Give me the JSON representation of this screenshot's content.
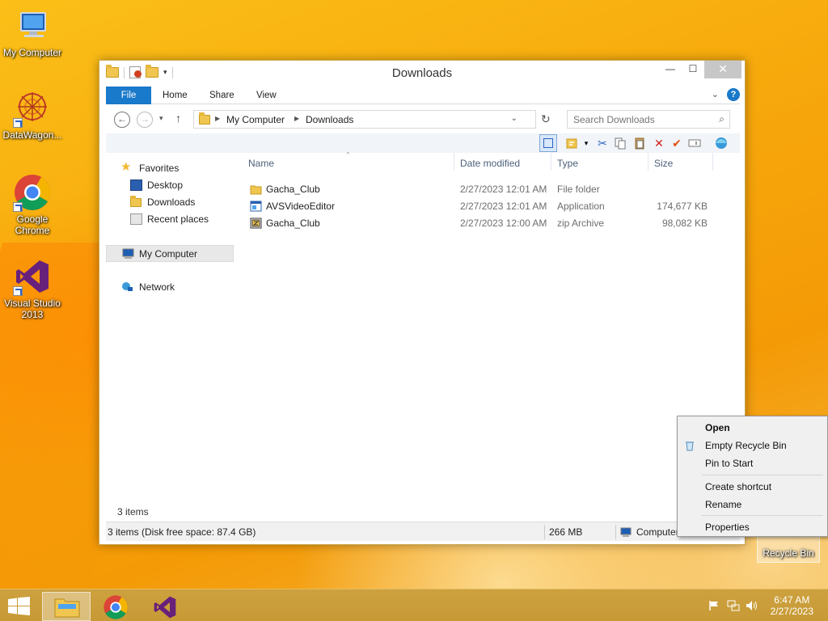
{
  "desktop": {
    "icons": [
      {
        "label": "My Computer"
      },
      {
        "label": "DataWagon..."
      },
      {
        "label": "Google Chrome"
      },
      {
        "label": "Visual Studio 2013"
      },
      {
        "label": "Recycle Bin"
      }
    ]
  },
  "window": {
    "title": "Downloads",
    "tabs": [
      "File",
      "Home",
      "Share",
      "View"
    ],
    "help_label": "?",
    "address": {
      "crumbs": [
        "My Computer",
        "Downloads"
      ]
    },
    "search": {
      "placeholder": "Search Downloads"
    },
    "nav": {
      "favorites": "Favorites",
      "desktop": "Desktop",
      "downloads": "Downloads",
      "recent": "Recent places",
      "computer": "My Computer",
      "network": "Network"
    },
    "columns": {
      "name": "Name",
      "date": "Date modified",
      "type": "Type",
      "size": "Size"
    },
    "files": [
      {
        "name": "Gacha_Club",
        "date": "2/27/2023 12:01 AM",
        "type": "File folder",
        "size": "",
        "icon": "folder-icon"
      },
      {
        "name": "AVSVideoEditor",
        "date": "2/27/2023 12:01 AM",
        "type": "Application",
        "size": "174,677 KB",
        "icon": "application-icon"
      },
      {
        "name": "Gacha_Club",
        "date": "2/27/2023 12:00 AM",
        "type": "zip Archive",
        "size": "98,082 KB",
        "icon": "zip-archive-icon"
      }
    ],
    "items_count": "3 items",
    "status": {
      "left": "3 items (Disk free space: 87.4 GB)",
      "size": "266 MB",
      "location": "Computer"
    }
  },
  "context_menu": {
    "open": "Open",
    "empty": "Empty Recycle Bin",
    "pin": "Pin to Start",
    "shortcut": "Create shortcut",
    "rename": "Rename",
    "properties": "Properties"
  },
  "taskbar": {
    "time": "6:47 AM",
    "date": "2/27/2023"
  }
}
